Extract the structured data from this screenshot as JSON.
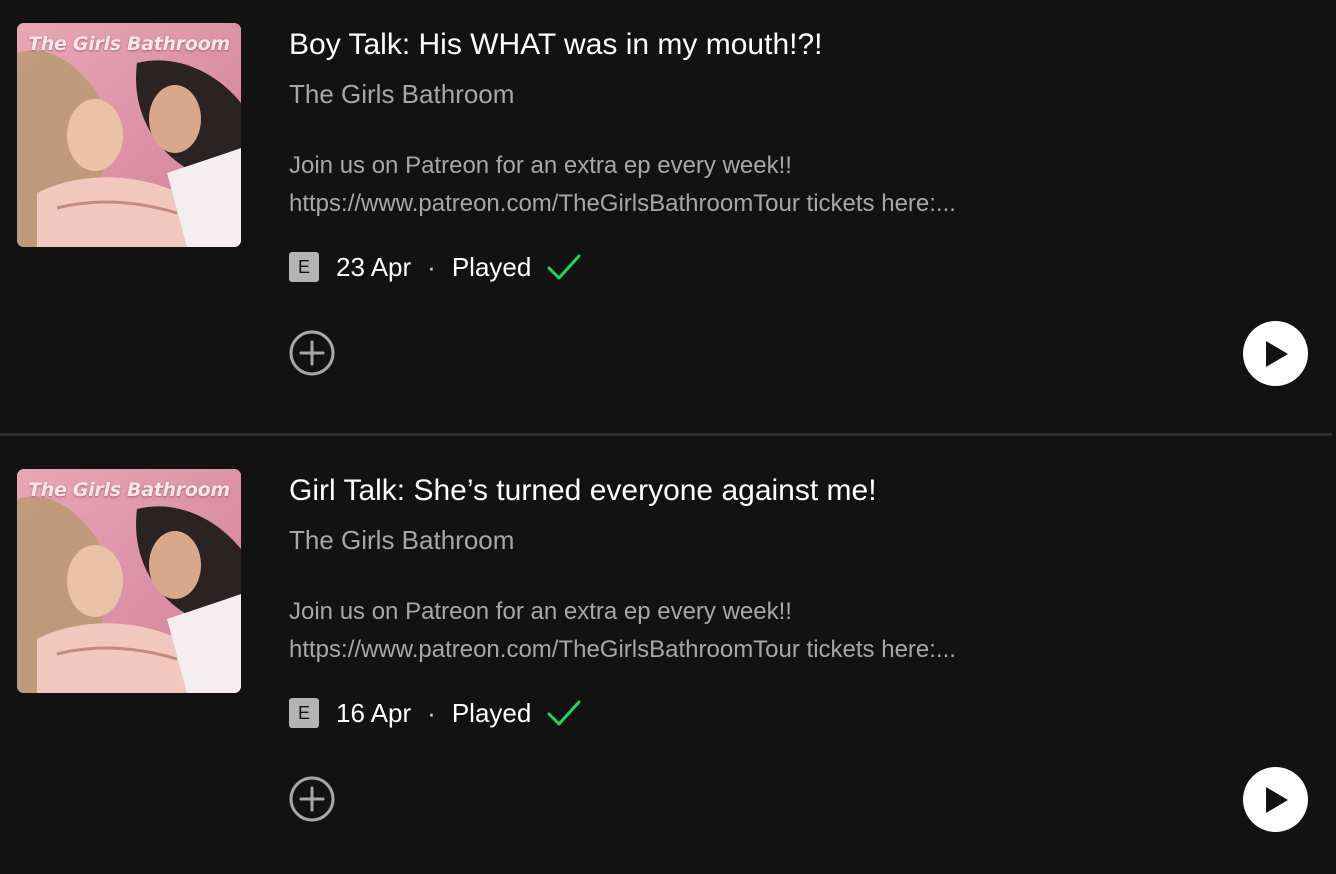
{
  "colors": {
    "background": "#121212",
    "primary_text": "#ffffff",
    "secondary_text": "#a7a7a7",
    "played_check": "#1ed760",
    "badge": "#b3b3b3"
  },
  "episodes": [
    {
      "cover_text": "The Girls Bathroom",
      "title": "Boy Talk: His WHAT was in my mouth!?!",
      "show": "The Girls Bathroom",
      "description_line1": "Join us on Patreon for an extra ep every week!!",
      "description_line2": "https://www.patreon.com/TheGirlsBathroomTour tickets here:...",
      "explicit_badge": "E",
      "date": "23 Apr",
      "separator": "·",
      "status": "Played",
      "icons": {
        "explicit": "explicit-badge",
        "played": "check-icon",
        "add": "add-circle-icon",
        "play": "play-icon"
      }
    },
    {
      "cover_text": "The Girls Bathroom",
      "title": "Girl Talk: She’s turned everyone against me!",
      "show": "The Girls Bathroom",
      "description_line1": "Join us on Patreon for an extra ep every week!!",
      "description_line2": "https://www.patreon.com/TheGirlsBathroomTour tickets here:...",
      "explicit_badge": "E",
      "date": "16 Apr",
      "separator": "·",
      "status": "Played",
      "icons": {
        "explicit": "explicit-badge",
        "played": "check-icon",
        "add": "add-circle-icon",
        "play": "play-icon"
      }
    }
  ]
}
